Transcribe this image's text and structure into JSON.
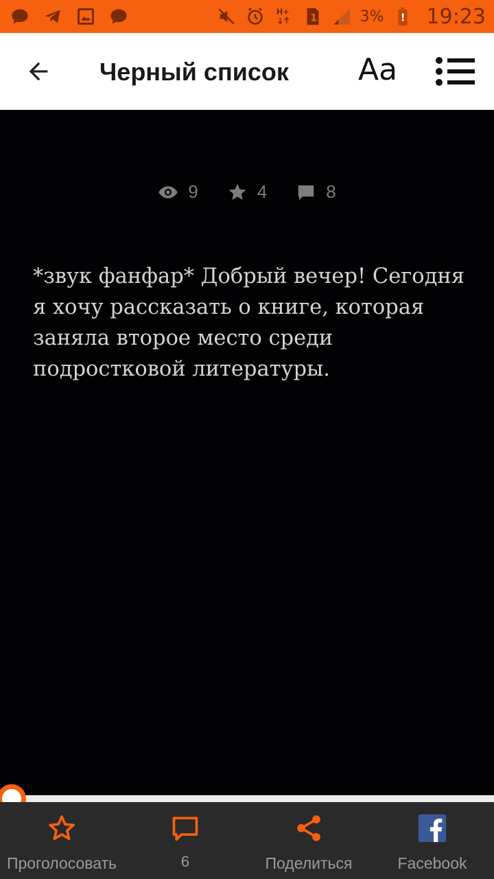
{
  "status_bar": {
    "battery_percent": "3%",
    "clock": "19:23",
    "network_label": "H+",
    "sim_label": "1",
    "accent_color": "#f5610e"
  },
  "app_bar": {
    "title": "Черный список",
    "font_button_label": "Aa"
  },
  "stats": {
    "views": "9",
    "stars": "4",
    "comments": "8"
  },
  "article": {
    "text": "*звук фанфар* Добрый вечер! Сегодня я хочу рассказать о книге, которая заняла второе место среди подростковой литературы."
  },
  "reading_progress": 0.0,
  "bottom_bar": {
    "vote_label": "Проголосовать",
    "comments_count": "6",
    "share_label": "Поделиться",
    "facebook_label": "Facebook"
  }
}
